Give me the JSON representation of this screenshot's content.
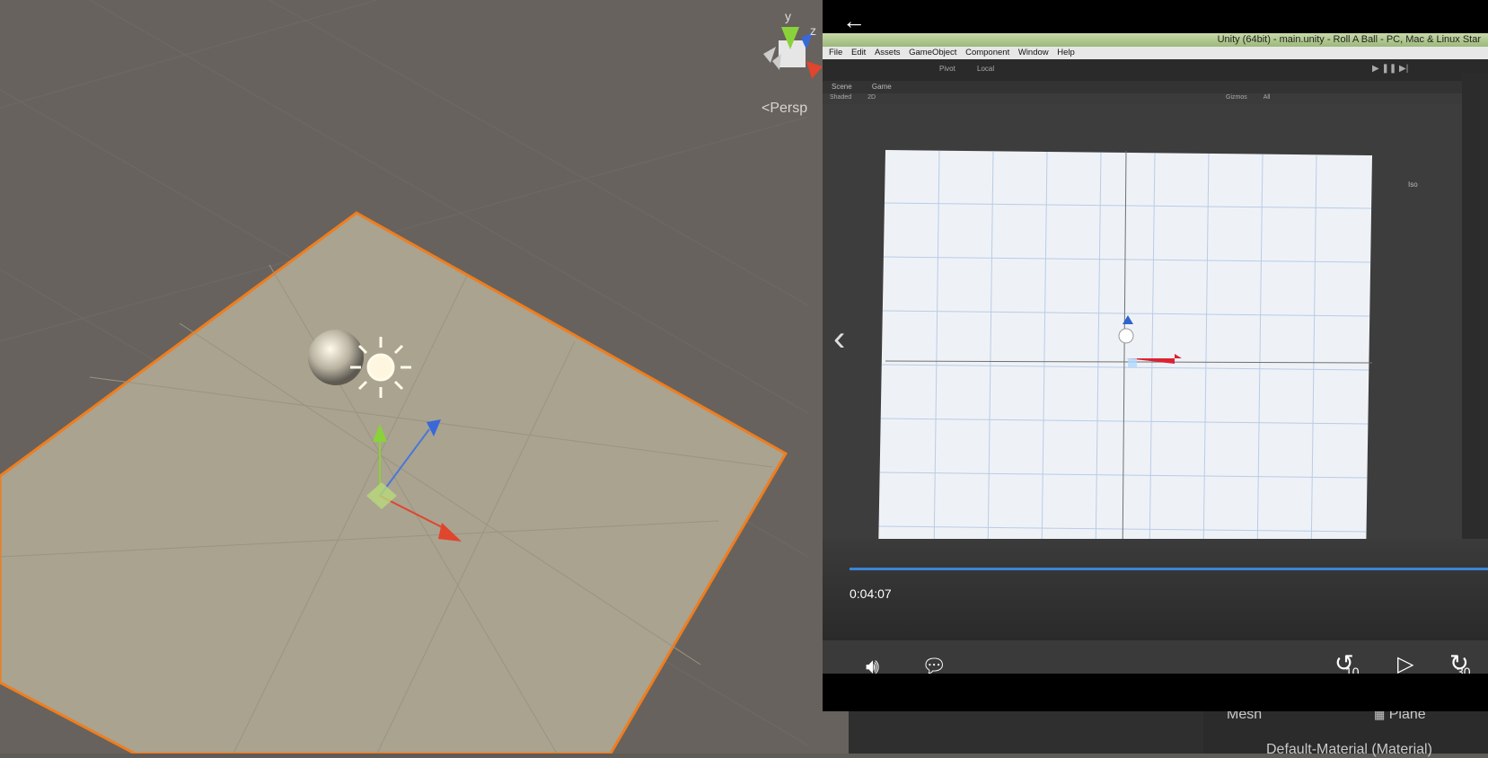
{
  "scene": {
    "persp_label": "Persp",
    "gizmo_axes": [
      "y",
      "z"
    ]
  },
  "inspector": {
    "mesh_label": "Mesh",
    "mesh_value": "Plane",
    "material_label": "Default-Material (Material)"
  },
  "player": {
    "back_icon": "back-arrow-icon",
    "video": {
      "window_title": "Unity (64bit) - main.unity - Roll A Ball - PC, Mac & Linux Star",
      "menu": [
        "File",
        "Edit",
        "Assets",
        "GameObject",
        "Component",
        "Window",
        "Help"
      ],
      "toolbar": {
        "pivot": "Pivot",
        "local": "Local"
      },
      "tabs": [
        "Scene",
        "Game"
      ],
      "scene_bar": [
        "Shaded",
        "2D",
        "Gizmos",
        "All"
      ],
      "iso_label": "Iso"
    },
    "time": "0:04:07",
    "progress_fraction": 1.0,
    "skip_back_label": "10",
    "skip_forward_label": "30"
  }
}
